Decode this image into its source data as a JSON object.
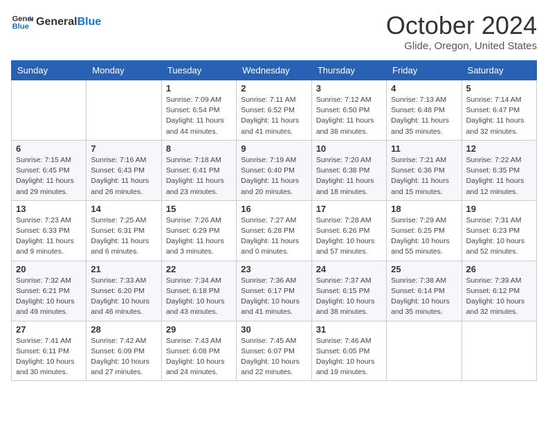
{
  "header": {
    "logo_line1": "General",
    "logo_line2": "Blue",
    "month_title": "October 2024",
    "location": "Glide, Oregon, United States"
  },
  "days_of_week": [
    "Sunday",
    "Monday",
    "Tuesday",
    "Wednesday",
    "Thursday",
    "Friday",
    "Saturday"
  ],
  "weeks": [
    [
      {
        "day": "",
        "info": ""
      },
      {
        "day": "",
        "info": ""
      },
      {
        "day": "1",
        "info": "Sunrise: 7:09 AM\nSunset: 6:54 PM\nDaylight: 11 hours and 44 minutes."
      },
      {
        "day": "2",
        "info": "Sunrise: 7:11 AM\nSunset: 6:52 PM\nDaylight: 11 hours and 41 minutes."
      },
      {
        "day": "3",
        "info": "Sunrise: 7:12 AM\nSunset: 6:50 PM\nDaylight: 11 hours and 38 minutes."
      },
      {
        "day": "4",
        "info": "Sunrise: 7:13 AM\nSunset: 6:48 PM\nDaylight: 11 hours and 35 minutes."
      },
      {
        "day": "5",
        "info": "Sunrise: 7:14 AM\nSunset: 6:47 PM\nDaylight: 11 hours and 32 minutes."
      }
    ],
    [
      {
        "day": "6",
        "info": "Sunrise: 7:15 AM\nSunset: 6:45 PM\nDaylight: 11 hours and 29 minutes."
      },
      {
        "day": "7",
        "info": "Sunrise: 7:16 AM\nSunset: 6:43 PM\nDaylight: 11 hours and 26 minutes."
      },
      {
        "day": "8",
        "info": "Sunrise: 7:18 AM\nSunset: 6:41 PM\nDaylight: 11 hours and 23 minutes."
      },
      {
        "day": "9",
        "info": "Sunrise: 7:19 AM\nSunset: 6:40 PM\nDaylight: 11 hours and 20 minutes."
      },
      {
        "day": "10",
        "info": "Sunrise: 7:20 AM\nSunset: 6:38 PM\nDaylight: 11 hours and 18 minutes."
      },
      {
        "day": "11",
        "info": "Sunrise: 7:21 AM\nSunset: 6:36 PM\nDaylight: 11 hours and 15 minutes."
      },
      {
        "day": "12",
        "info": "Sunrise: 7:22 AM\nSunset: 6:35 PM\nDaylight: 11 hours and 12 minutes."
      }
    ],
    [
      {
        "day": "13",
        "info": "Sunrise: 7:23 AM\nSunset: 6:33 PM\nDaylight: 11 hours and 9 minutes."
      },
      {
        "day": "14",
        "info": "Sunrise: 7:25 AM\nSunset: 6:31 PM\nDaylight: 11 hours and 6 minutes."
      },
      {
        "day": "15",
        "info": "Sunrise: 7:26 AM\nSunset: 6:29 PM\nDaylight: 11 hours and 3 minutes."
      },
      {
        "day": "16",
        "info": "Sunrise: 7:27 AM\nSunset: 6:28 PM\nDaylight: 11 hours and 0 minutes."
      },
      {
        "day": "17",
        "info": "Sunrise: 7:28 AM\nSunset: 6:26 PM\nDaylight: 10 hours and 57 minutes."
      },
      {
        "day": "18",
        "info": "Sunrise: 7:29 AM\nSunset: 6:25 PM\nDaylight: 10 hours and 55 minutes."
      },
      {
        "day": "19",
        "info": "Sunrise: 7:31 AM\nSunset: 6:23 PM\nDaylight: 10 hours and 52 minutes."
      }
    ],
    [
      {
        "day": "20",
        "info": "Sunrise: 7:32 AM\nSunset: 6:21 PM\nDaylight: 10 hours and 49 minutes."
      },
      {
        "day": "21",
        "info": "Sunrise: 7:33 AM\nSunset: 6:20 PM\nDaylight: 10 hours and 46 minutes."
      },
      {
        "day": "22",
        "info": "Sunrise: 7:34 AM\nSunset: 6:18 PM\nDaylight: 10 hours and 43 minutes."
      },
      {
        "day": "23",
        "info": "Sunrise: 7:36 AM\nSunset: 6:17 PM\nDaylight: 10 hours and 41 minutes."
      },
      {
        "day": "24",
        "info": "Sunrise: 7:37 AM\nSunset: 6:15 PM\nDaylight: 10 hours and 38 minutes."
      },
      {
        "day": "25",
        "info": "Sunrise: 7:38 AM\nSunset: 6:14 PM\nDaylight: 10 hours and 35 minutes."
      },
      {
        "day": "26",
        "info": "Sunrise: 7:39 AM\nSunset: 6:12 PM\nDaylight: 10 hours and 32 minutes."
      }
    ],
    [
      {
        "day": "27",
        "info": "Sunrise: 7:41 AM\nSunset: 6:11 PM\nDaylight: 10 hours and 30 minutes."
      },
      {
        "day": "28",
        "info": "Sunrise: 7:42 AM\nSunset: 6:09 PM\nDaylight: 10 hours and 27 minutes."
      },
      {
        "day": "29",
        "info": "Sunrise: 7:43 AM\nSunset: 6:08 PM\nDaylight: 10 hours and 24 minutes."
      },
      {
        "day": "30",
        "info": "Sunrise: 7:45 AM\nSunset: 6:07 PM\nDaylight: 10 hours and 22 minutes."
      },
      {
        "day": "31",
        "info": "Sunrise: 7:46 AM\nSunset: 6:05 PM\nDaylight: 10 hours and 19 minutes."
      },
      {
        "day": "",
        "info": ""
      },
      {
        "day": "",
        "info": ""
      }
    ]
  ]
}
